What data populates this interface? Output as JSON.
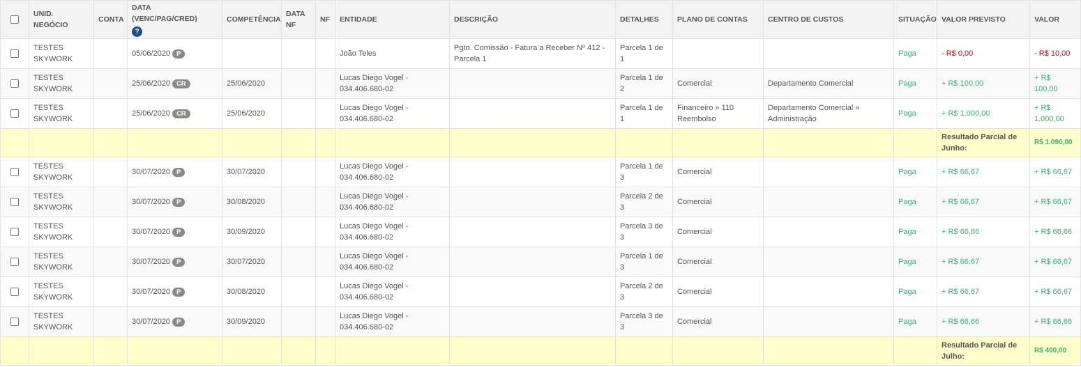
{
  "headers": {
    "unid": "UNID. NEGÓCIO",
    "conta": "CONTA",
    "data": "DATA (VENC/PAG/CRED)",
    "competencia": "COMPETÊNCIA",
    "data_nf": "DATA NF",
    "nf": "NF",
    "entidade": "ENTIDADE",
    "descricao": "DESCRIÇÃO",
    "detalhes": "DETALHES",
    "plano": "PLANO DE CONTAS",
    "centro": "CENTRO DE CUSTOS",
    "situacao": "SITUAÇÃO",
    "previsto": "VALOR PREVISTO",
    "valor": "VALOR"
  },
  "help_icon_glyph": "?",
  "rows": [
    {
      "unid": "TESTES SKYWORK",
      "conta": "",
      "data": "05/06/2020",
      "badge": "P",
      "competencia": "",
      "data_nf": "",
      "nf": "",
      "entidade": "João Teles",
      "descricao": "Pgto. Comissão - Fatura a Receber Nº 412 - Parcela 1",
      "detalhes": "Parcela 1 de 1",
      "plano": "",
      "centro": "",
      "situacao": "Paga",
      "previsto": "- R$ 0,00",
      "valor": "- R$ 10,00",
      "sign": "neg"
    },
    {
      "unid": "TESTES SKYWORK",
      "conta": "",
      "data": "25/06/2020",
      "badge": "CR",
      "competencia": "25/06/2020",
      "data_nf": "",
      "nf": "",
      "entidade": "Lucas Diego Vogel - 034.406.680-02",
      "descricao": "",
      "detalhes": "Parcela 1 de 2",
      "plano": "Comercial",
      "centro": "Departamento Comercial",
      "situacao": "Paga",
      "previsto": "+ R$ 100,00",
      "valor": "+ R$ 100,00",
      "sign": "pos"
    },
    {
      "unid": "TESTES SKYWORK",
      "conta": "",
      "data": "25/06/2020",
      "badge": "CR",
      "competencia": "25/06/2020",
      "data_nf": "",
      "nf": "",
      "entidade": "Lucas Diego Vogel - 034.406.680-02",
      "descricao": "",
      "detalhes": "Parcela 1 de 1",
      "plano": "Financeiro » 110 Reembolso",
      "centro": "Departamento Comercial » Administração",
      "situacao": "Paga",
      "previsto": "+ R$ 1.000,00",
      "valor": "+ R$ 1.000,00",
      "sign": "pos"
    },
    {
      "subtotal": true,
      "label": "Resultado Parcial de Junho:",
      "value": "R$ 1.090,00"
    },
    {
      "unid": "TESTES SKYWORK",
      "conta": "",
      "data": "30/07/2020",
      "badge": "P",
      "competencia": "30/07/2020",
      "data_nf": "",
      "nf": "",
      "entidade": "Lucas Diego Vogel - 034.406.680-02",
      "descricao": "",
      "detalhes": "Parcela 1 de 3",
      "plano": "Comercial",
      "centro": "",
      "situacao": "Paga",
      "previsto": "+ R$ 66,67",
      "valor": "+ R$ 66,67",
      "sign": "pos"
    },
    {
      "unid": "TESTES SKYWORK",
      "conta": "",
      "data": "30/07/2020",
      "badge": "P",
      "competencia": "30/08/2020",
      "data_nf": "",
      "nf": "",
      "entidade": "Lucas Diego Vogel - 034.406.680-02",
      "descricao": "",
      "detalhes": "Parcela 2 de 3",
      "plano": "Comercial",
      "centro": "",
      "situacao": "Paga",
      "previsto": "+ R$ 66,67",
      "valor": "+ R$ 66,67",
      "sign": "pos"
    },
    {
      "unid": "TESTES SKYWORK",
      "conta": "",
      "data": "30/07/2020",
      "badge": "P",
      "competencia": "30/09/2020",
      "data_nf": "",
      "nf": "",
      "entidade": "Lucas Diego Vogel - 034.406.680-02",
      "descricao": "",
      "detalhes": "Parcela 3 de 3",
      "plano": "Comercial",
      "centro": "",
      "situacao": "Paga",
      "previsto": "+ R$ 66,66",
      "valor": "+ R$ 66,66",
      "sign": "pos"
    },
    {
      "unid": "TESTES SKYWORK",
      "conta": "",
      "data": "30/07/2020",
      "badge": "P",
      "competencia": "30/07/2020",
      "data_nf": "",
      "nf": "",
      "entidade": "Lucas Diego Vogel - 034.406.680-02",
      "descricao": "",
      "detalhes": "Parcela 1 de 3",
      "plano": "Comercial",
      "centro": "",
      "situacao": "Paga",
      "previsto": "+ R$ 66,67",
      "valor": "+ R$ 66,67",
      "sign": "pos"
    },
    {
      "unid": "TESTES SKYWORK",
      "conta": "",
      "data": "30/07/2020",
      "badge": "P",
      "competencia": "30/08/2020",
      "data_nf": "",
      "nf": "",
      "entidade": "Lucas Diego Vogel - 034.406.680-02",
      "descricao": "",
      "detalhes": "Parcela 2 de 3",
      "plano": "Comercial",
      "centro": "",
      "situacao": "Paga",
      "previsto": "+ R$ 66,67",
      "valor": "+ R$ 66,67",
      "sign": "pos"
    },
    {
      "unid": "TESTES SKYWORK",
      "conta": "",
      "data": "30/07/2020",
      "badge": "P",
      "competencia": "30/09/2020",
      "data_nf": "",
      "nf": "",
      "entidade": "Lucas Diego Vogel - 034.406.680-02",
      "descricao": "",
      "detalhes": "Parcela 3 de 3",
      "plano": "Comercial",
      "centro": "",
      "situacao": "Paga",
      "previsto": "+ R$ 66,66",
      "valor": "+ R$ 66,66",
      "sign": "pos"
    },
    {
      "subtotal": true,
      "label": "Resultado Parcial de Julho:",
      "value": "R$ 400,00"
    }
  ],
  "colors": {
    "positive": "#3bb36f",
    "negative": "#d0021b",
    "subtotal_bg": "#ffffcc",
    "help_icon": "#1f4e8c"
  }
}
